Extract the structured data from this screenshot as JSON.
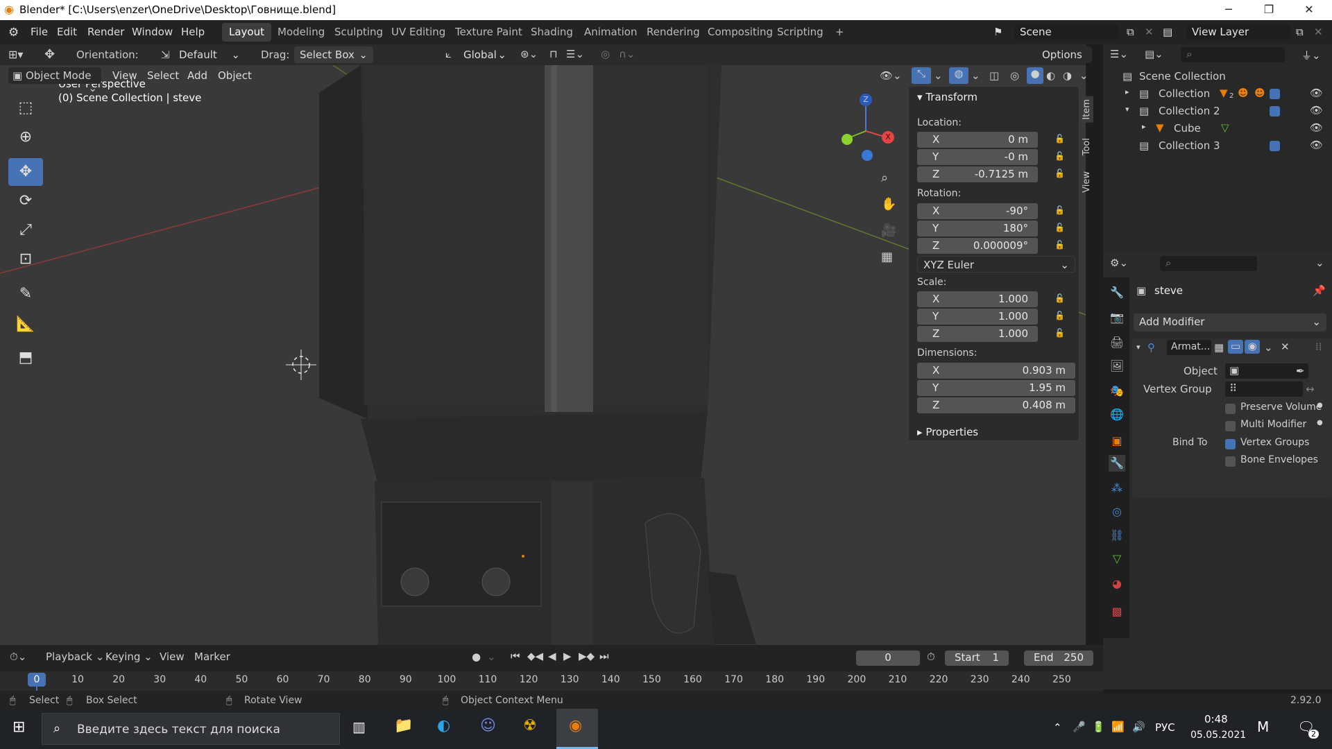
{
  "window": {
    "title": "Blender* [C:\\Users\\enzer\\OneDrive\\Desktop\\Говнище.blend]",
    "min": "─",
    "max": "❐",
    "close": "✕"
  },
  "menu": {
    "items": [
      "File",
      "Edit",
      "Render",
      "Window",
      "Help"
    ]
  },
  "workspaces": [
    "Layout",
    "Modeling",
    "Sculpting",
    "UV Editing",
    "Texture Paint",
    "Shading",
    "Animation",
    "Rendering",
    "Compositing",
    "Scripting",
    "+"
  ],
  "scene": {
    "label": "Scene",
    "view_layer": "View Layer"
  },
  "header": {
    "orientation_label": "Orientation:",
    "orientation_value": "Default",
    "drag_label": "Drag:",
    "drag_value": "Select Box",
    "transform": "Global",
    "options": "Options"
  },
  "viewport_menu": {
    "mode": "Object Mode",
    "items": [
      "View",
      "Select",
      "Add",
      "Object"
    ]
  },
  "viewport": {
    "perspective": "User Perspective",
    "collection_info": "(0) Scene Collection | steve"
  },
  "gizmo": {
    "x": "X",
    "y": "Y",
    "z": "Z"
  },
  "npanel": {
    "transform_title": "Transform",
    "location_label": "Location:",
    "location": [
      {
        "a": "X",
        "v": "0 m"
      },
      {
        "a": "Y",
        "v": "-0 m"
      },
      {
        "a": "Z",
        "v": "-0.7125 m"
      }
    ],
    "rotation_label": "Rotation:",
    "rotation": [
      {
        "a": "X",
        "v": "-90°"
      },
      {
        "a": "Y",
        "v": "180°"
      },
      {
        "a": "Z",
        "v": "0.000009°"
      }
    ],
    "rotation_mode": "XYZ Euler",
    "scale_label": "Scale:",
    "scale": [
      {
        "a": "X",
        "v": "1.000"
      },
      {
        "a": "Y",
        "v": "1.000"
      },
      {
        "a": "Z",
        "v": "1.000"
      }
    ],
    "dimensions_label": "Dimensions:",
    "dimensions": [
      {
        "a": "X",
        "v": "0.903 m"
      },
      {
        "a": "Y",
        "v": "1.95 m"
      },
      {
        "a": "Z",
        "v": "0.408 m"
      }
    ],
    "properties_title": "Properties",
    "tabs": [
      "Item",
      "Tool",
      "View"
    ]
  },
  "outliner": {
    "root": "Scene Collection",
    "items": [
      {
        "label": "Collection",
        "badge": "2"
      },
      {
        "label": "Collection 2"
      },
      {
        "label": "Cube"
      },
      {
        "label": "Collection 3"
      }
    ]
  },
  "properties": {
    "object_name": "steve",
    "add_modifier": "Add Modifier",
    "modifier_name": "Armat...",
    "object_label": "Object",
    "vertex_group_label": "Vertex Group",
    "preserve_volume": "Preserve Volume",
    "multi_modifier": "Multi Modifier",
    "bind_to_label": "Bind To",
    "vertex_groups": "Vertex Groups",
    "bone_envelopes": "Bone Envelopes"
  },
  "timeline": {
    "menus": [
      "Playback",
      "Keying",
      "View",
      "Marker"
    ],
    "current_frame": "0",
    "start_label": "Start",
    "start": "1",
    "end_label": "End",
    "end": "250",
    "frames": [
      "0",
      "10",
      "20",
      "30",
      "40",
      "50",
      "60",
      "70",
      "80",
      "90",
      "100",
      "110",
      "120",
      "130",
      "140",
      "150",
      "160",
      "170",
      "180",
      "190",
      "200",
      "210",
      "220",
      "230",
      "240",
      "250"
    ]
  },
  "status": {
    "select": "Select",
    "box_select": "Box Select",
    "rotate_view": "Rotate View",
    "context_menu": "Object Context Menu",
    "version": "2.92.0"
  },
  "taskbar": {
    "search_placeholder": "Введите здесь текст для поиска",
    "lang": "РУС",
    "time": "0:48",
    "date": "05.05.2021",
    "notif_count": "2"
  }
}
